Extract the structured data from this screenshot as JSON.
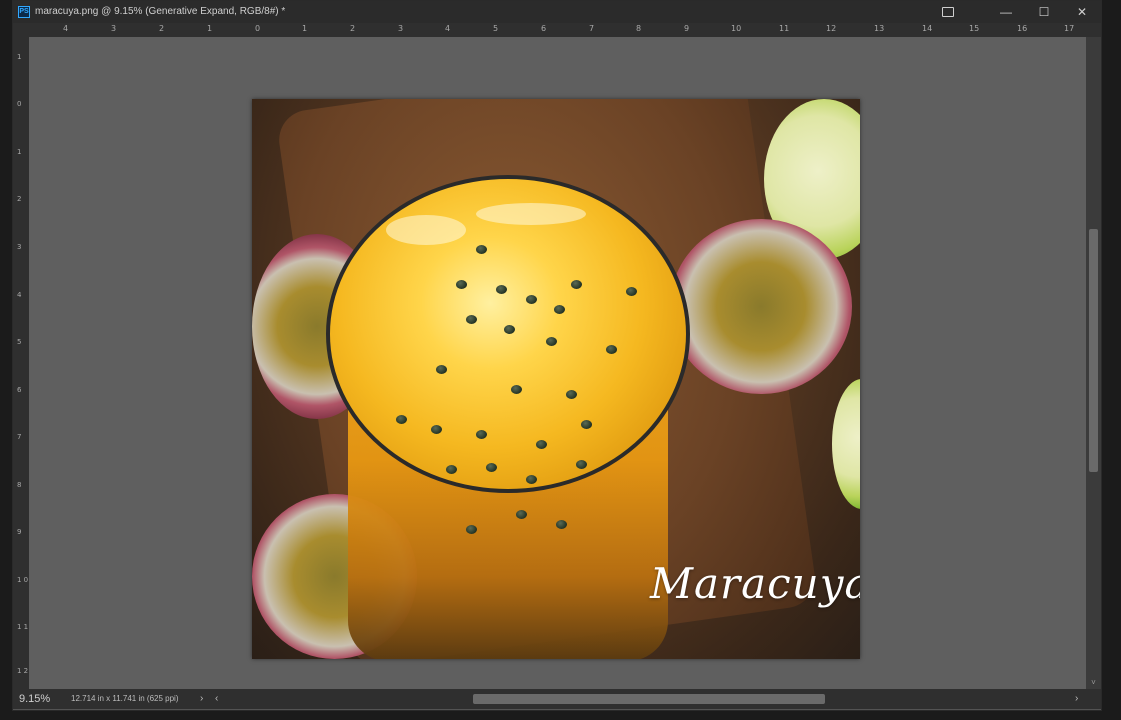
{
  "titlebar": {
    "app_icon": "PS",
    "title": "maracuya.png @ 9.15% (Generative Expand, RGB/8#) *",
    "controls": {
      "minimize": "—",
      "maximize": "☐",
      "close": "✕"
    }
  },
  "rulers": {
    "horizontal_ticks": [
      "4",
      "3",
      "2",
      "1",
      "0",
      "1",
      "2",
      "3",
      "4",
      "5",
      "6",
      "7",
      "8",
      "9",
      "10",
      "11",
      "12",
      "13",
      "14",
      "15",
      "16",
      "17"
    ],
    "vertical_ticks": [
      "1",
      "0",
      "1",
      "2",
      "3",
      "4",
      "5",
      "6",
      "7",
      "8",
      "9",
      "1\n0",
      "1\n1",
      "1\n2"
    ]
  },
  "canvas": {
    "image_text": "Maracuya"
  },
  "statusbar": {
    "zoom": "9.15%",
    "doc_info": "12.714 in x 11.741 in (625 ppi)",
    "expand_arrow": "›",
    "scroll_left": "‹",
    "scroll_right": "›"
  },
  "scrollbar_v": {
    "up": "˄",
    "down": "˅"
  }
}
